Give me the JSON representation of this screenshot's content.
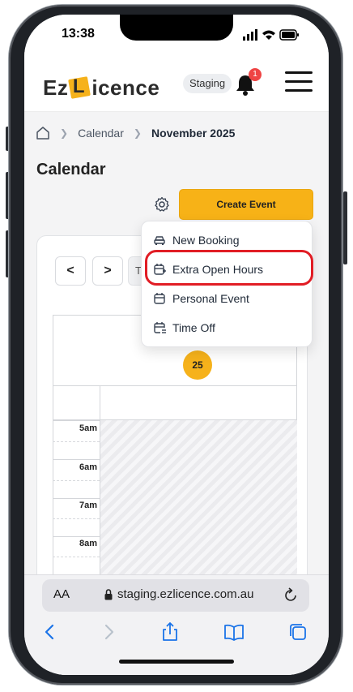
{
  "status_bar": {
    "time": "13:38"
  },
  "header": {
    "logo_prefix": "Ez",
    "logo_badge_letter": "L",
    "logo_suffix": "icence",
    "environment_badge": "Staging",
    "notification_count": "1",
    "brand_color": "#f6b21b"
  },
  "breadcrumb": {
    "items": [
      "Calendar",
      "November 2025"
    ]
  },
  "page": {
    "title": "Calendar"
  },
  "toolbar": {
    "create_label": "Create Event"
  },
  "calendar": {
    "prev_label": "<",
    "next_label": ">",
    "today_label_partial": "T",
    "day_number": "25",
    "hours": [
      "5am",
      "6am",
      "7am",
      "8am"
    ]
  },
  "dropdown": {
    "items": [
      {
        "label": "New Booking",
        "icon": "car-icon"
      },
      {
        "label": "Extra Open Hours",
        "icon": "calendar-plus-icon"
      },
      {
        "label": "Personal Event",
        "icon": "calendar-icon"
      },
      {
        "label": "Time Off",
        "icon": "calendar-clock-icon"
      }
    ],
    "highlight_color": "#e11d25"
  },
  "browser": {
    "aa_label": "AA",
    "url": "staging.ezlicence.com.au"
  }
}
